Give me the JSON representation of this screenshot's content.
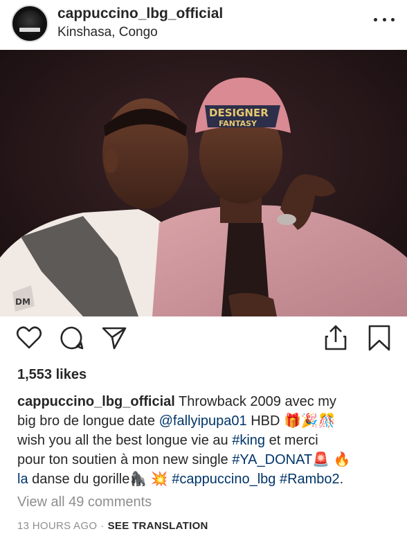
{
  "post": {
    "username": "cappuccino_lbg_official",
    "location": "Kinshasa, Congo",
    "avatar_icon": "profile-avatar",
    "more_icon": "more-options-icon"
  },
  "actions": {
    "like_icon": "heart-icon",
    "comment_icon": "comment-bubble-icon",
    "share_icon": "paper-plane-icon",
    "upload_icon": "upload-share-icon",
    "save_icon": "bookmark-icon"
  },
  "likes": "1,553 likes",
  "caption": {
    "username": "cappuccino_lbg_official",
    "line1_text": " Throwback 2009 avec my",
    "line2_text_a": "big bro de longue date ",
    "line2_mention": "@fallyipupa01",
    "line2_text_b": " HBD 🎁🎉🎊",
    "line3_text_a": "wish you all the best longue vie au ",
    "line3_tag": "#king",
    "line3_text_b": " et merci",
    "line4_text_a": "pour ton soutien à mon new single ",
    "line4_tag": "#YA_DONAT",
    "line4_text_b": "🚨 🔥",
    "line5_tag_a": "la",
    "line5_text": " danse du gorille🦍 💥 ",
    "line5_tag_b": "#cappuccino_lbg",
    "line5_space": " ",
    "line5_tag_c": "#Rambo2",
    "line5_end": "."
  },
  "comments_link": "View all 49 comments",
  "timestamp": "13 HOURS AGO",
  "separator": "·",
  "see_translation": "SEE TRANSLATION",
  "photo_caption_visible": "DESIGNER FANTASY",
  "colors": {
    "text": "#262626",
    "link": "#003569",
    "muted": "#8e8e8e"
  }
}
